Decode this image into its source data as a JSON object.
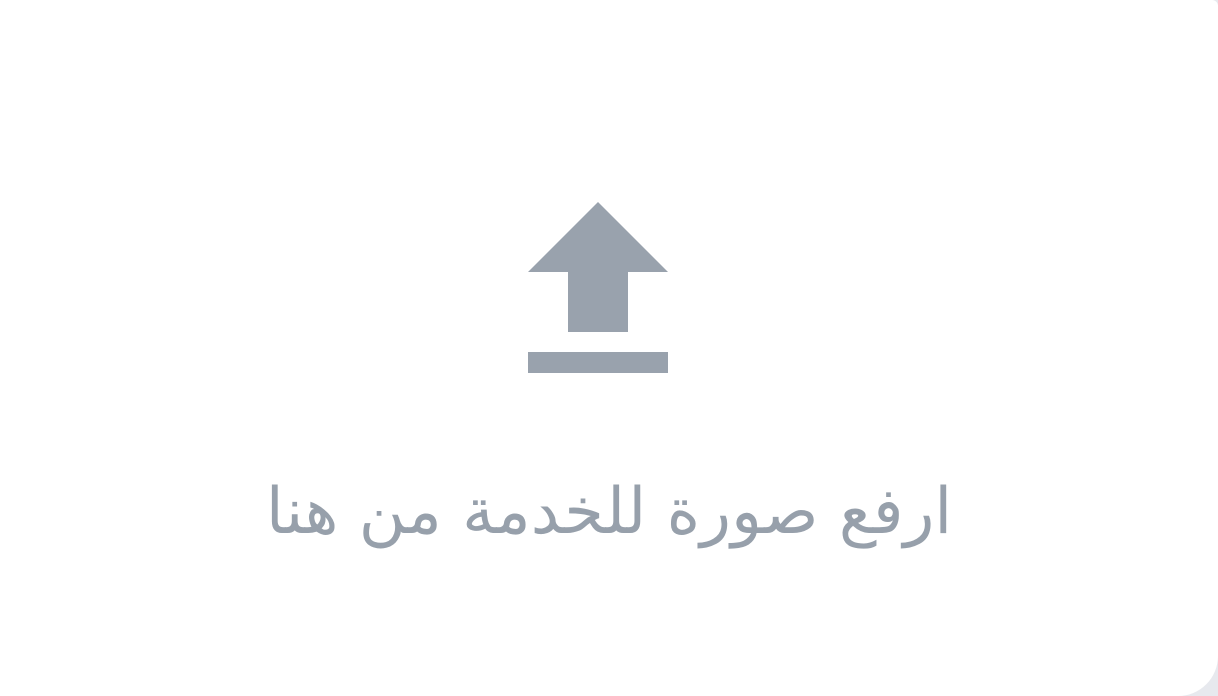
{
  "dropzone": {
    "label": "ارفع صورة للخدمة من هنا",
    "icon": "upload-icon"
  },
  "colors": {
    "icon": "#99a2ad",
    "text": "#97a0ab",
    "surface": "#ffffff",
    "backdrop": "#e7e9ee"
  }
}
